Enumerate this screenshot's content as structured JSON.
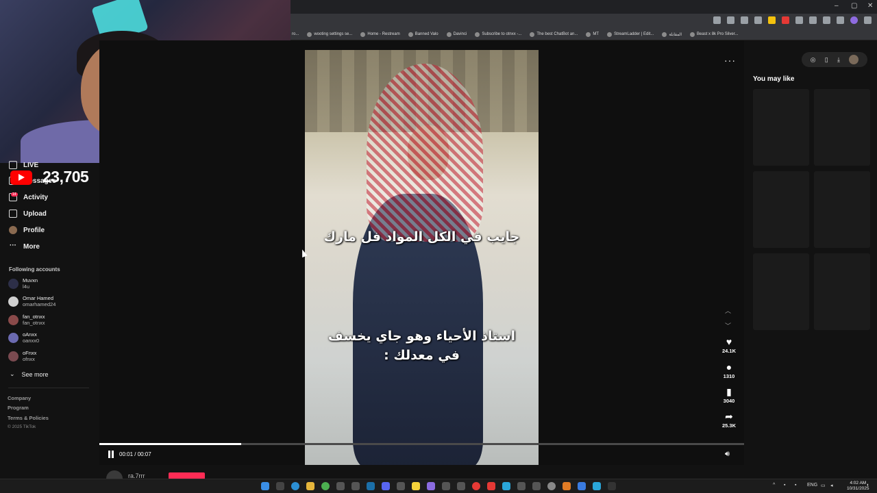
{
  "browser": {
    "window_controls": [
      "–",
      "▢",
      "✕"
    ],
    "bookmarks": [
      {
        "label": "ro..."
      },
      {
        "label": "wooting settings se..."
      },
      {
        "label": "Home - Restream"
      },
      {
        "label": "Banned Valo"
      },
      {
        "label": "Davinci"
      },
      {
        "label": "Subscribe to otnxx -..."
      },
      {
        "label": "The best ChatBot an..."
      },
      {
        "label": "MT"
      },
      {
        "label": "StreamLadder | Edit..."
      },
      {
        "label": "المقابلة"
      },
      {
        "label": "Beast x 8k Pro Silver..."
      }
    ]
  },
  "stream_overlay": {
    "viewer_count": "23,705"
  },
  "sidebar": {
    "items": [
      {
        "label": "LIVE"
      },
      {
        "label": "Messages"
      },
      {
        "label": "Activity",
        "badge": "14"
      },
      {
        "label": "Upload"
      },
      {
        "label": "Profile"
      },
      {
        "label": "More"
      }
    ],
    "following_title": "Following accounts",
    "accounts": [
      {
        "name": "Muvxn",
        "handle": "l4u"
      },
      {
        "name": "Omar Hamed",
        "handle": "omarhamed24"
      },
      {
        "name": "fan_otnxx",
        "handle": "fan_otnxx"
      },
      {
        "name": "oAnxx",
        "handle": "oanxx0"
      },
      {
        "name": "oFnxx",
        "handle": "ofnxx"
      }
    ],
    "see_more": "See more",
    "footer": [
      "Company",
      "Program",
      "Terms & Policies"
    ],
    "copyright": "© 2025 TikTok"
  },
  "video": {
    "caption_top": "جايب في الكل المواد فل مارك",
    "caption_bottom_line1": "استاذ الأحياء وهو جاي يخسف",
    "caption_bottom_line2": "في معدلك :",
    "time": "00:01 / 00:07",
    "progress": 0.22,
    "author": "ra.7rrr"
  },
  "actions": {
    "likes": "24.1K",
    "comments": "1310",
    "saves": "3040",
    "shares": "25.3K"
  },
  "right_panel": {
    "title": "You may like"
  },
  "taskbar": {
    "language": "ENG",
    "time": "4:02 AM",
    "date": "10/31/2025"
  }
}
